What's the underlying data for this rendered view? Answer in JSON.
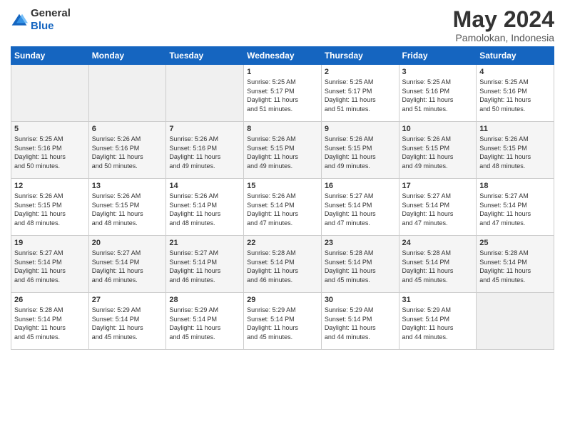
{
  "header": {
    "logo_general": "General",
    "logo_blue": "Blue",
    "month_title": "May 2024",
    "location": "Pamolokan, Indonesia"
  },
  "weekdays": [
    "Sunday",
    "Monday",
    "Tuesday",
    "Wednesday",
    "Thursday",
    "Friday",
    "Saturday"
  ],
  "weeks": [
    [
      {
        "day": "",
        "info": ""
      },
      {
        "day": "",
        "info": ""
      },
      {
        "day": "",
        "info": ""
      },
      {
        "day": "1",
        "info": "Sunrise: 5:25 AM\nSunset: 5:17 PM\nDaylight: 11 hours\nand 51 minutes."
      },
      {
        "day": "2",
        "info": "Sunrise: 5:25 AM\nSunset: 5:17 PM\nDaylight: 11 hours\nand 51 minutes."
      },
      {
        "day": "3",
        "info": "Sunrise: 5:25 AM\nSunset: 5:16 PM\nDaylight: 11 hours\nand 51 minutes."
      },
      {
        "day": "4",
        "info": "Sunrise: 5:25 AM\nSunset: 5:16 PM\nDaylight: 11 hours\nand 50 minutes."
      }
    ],
    [
      {
        "day": "5",
        "info": "Sunrise: 5:25 AM\nSunset: 5:16 PM\nDaylight: 11 hours\nand 50 minutes."
      },
      {
        "day": "6",
        "info": "Sunrise: 5:26 AM\nSunset: 5:16 PM\nDaylight: 11 hours\nand 50 minutes."
      },
      {
        "day": "7",
        "info": "Sunrise: 5:26 AM\nSunset: 5:16 PM\nDaylight: 11 hours\nand 49 minutes."
      },
      {
        "day": "8",
        "info": "Sunrise: 5:26 AM\nSunset: 5:15 PM\nDaylight: 11 hours\nand 49 minutes."
      },
      {
        "day": "9",
        "info": "Sunrise: 5:26 AM\nSunset: 5:15 PM\nDaylight: 11 hours\nand 49 minutes."
      },
      {
        "day": "10",
        "info": "Sunrise: 5:26 AM\nSunset: 5:15 PM\nDaylight: 11 hours\nand 49 minutes."
      },
      {
        "day": "11",
        "info": "Sunrise: 5:26 AM\nSunset: 5:15 PM\nDaylight: 11 hours\nand 48 minutes."
      }
    ],
    [
      {
        "day": "12",
        "info": "Sunrise: 5:26 AM\nSunset: 5:15 PM\nDaylight: 11 hours\nand 48 minutes."
      },
      {
        "day": "13",
        "info": "Sunrise: 5:26 AM\nSunset: 5:15 PM\nDaylight: 11 hours\nand 48 minutes."
      },
      {
        "day": "14",
        "info": "Sunrise: 5:26 AM\nSunset: 5:14 PM\nDaylight: 11 hours\nand 48 minutes."
      },
      {
        "day": "15",
        "info": "Sunrise: 5:26 AM\nSunset: 5:14 PM\nDaylight: 11 hours\nand 47 minutes."
      },
      {
        "day": "16",
        "info": "Sunrise: 5:27 AM\nSunset: 5:14 PM\nDaylight: 11 hours\nand 47 minutes."
      },
      {
        "day": "17",
        "info": "Sunrise: 5:27 AM\nSunset: 5:14 PM\nDaylight: 11 hours\nand 47 minutes."
      },
      {
        "day": "18",
        "info": "Sunrise: 5:27 AM\nSunset: 5:14 PM\nDaylight: 11 hours\nand 47 minutes."
      }
    ],
    [
      {
        "day": "19",
        "info": "Sunrise: 5:27 AM\nSunset: 5:14 PM\nDaylight: 11 hours\nand 46 minutes."
      },
      {
        "day": "20",
        "info": "Sunrise: 5:27 AM\nSunset: 5:14 PM\nDaylight: 11 hours\nand 46 minutes."
      },
      {
        "day": "21",
        "info": "Sunrise: 5:27 AM\nSunset: 5:14 PM\nDaylight: 11 hours\nand 46 minutes."
      },
      {
        "day": "22",
        "info": "Sunrise: 5:28 AM\nSunset: 5:14 PM\nDaylight: 11 hours\nand 46 minutes."
      },
      {
        "day": "23",
        "info": "Sunrise: 5:28 AM\nSunset: 5:14 PM\nDaylight: 11 hours\nand 45 minutes."
      },
      {
        "day": "24",
        "info": "Sunrise: 5:28 AM\nSunset: 5:14 PM\nDaylight: 11 hours\nand 45 minutes."
      },
      {
        "day": "25",
        "info": "Sunrise: 5:28 AM\nSunset: 5:14 PM\nDaylight: 11 hours\nand 45 minutes."
      }
    ],
    [
      {
        "day": "26",
        "info": "Sunrise: 5:28 AM\nSunset: 5:14 PM\nDaylight: 11 hours\nand 45 minutes."
      },
      {
        "day": "27",
        "info": "Sunrise: 5:29 AM\nSunset: 5:14 PM\nDaylight: 11 hours\nand 45 minutes."
      },
      {
        "day": "28",
        "info": "Sunrise: 5:29 AM\nSunset: 5:14 PM\nDaylight: 11 hours\nand 45 minutes."
      },
      {
        "day": "29",
        "info": "Sunrise: 5:29 AM\nSunset: 5:14 PM\nDaylight: 11 hours\nand 45 minutes."
      },
      {
        "day": "30",
        "info": "Sunrise: 5:29 AM\nSunset: 5:14 PM\nDaylight: 11 hours\nand 44 minutes."
      },
      {
        "day": "31",
        "info": "Sunrise: 5:29 AM\nSunset: 5:14 PM\nDaylight: 11 hours\nand 44 minutes."
      },
      {
        "day": "",
        "info": ""
      }
    ]
  ]
}
